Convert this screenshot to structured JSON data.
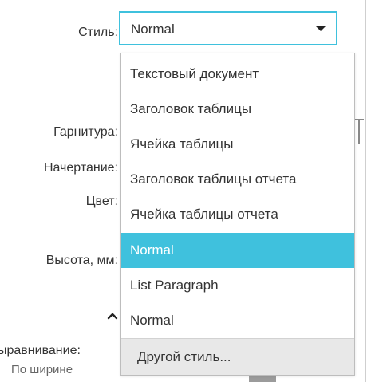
{
  "form": {
    "style_label": "Стиль:",
    "font_label": "Гарнитура:",
    "face_label": "Начертание:",
    "color_label": "Цвет:",
    "height_label": "Высота, мм:",
    "align_label": "ыравнивание:",
    "align_value": "По ширине"
  },
  "style_select": {
    "value": "Normal"
  },
  "dropdown": {
    "options": [
      "Текстовый документ",
      "Заголовок таблицы",
      "Ячейка таблицы",
      "Заголовок таблицы отчета",
      "Ячейка таблицы отчета",
      "Normal",
      "List Paragraph",
      "Normal"
    ],
    "selected_index": 5,
    "other_style": "Другой стиль..."
  },
  "icons": {
    "select_caret": "caret-down-icon",
    "collapse": "chevron-up-icon"
  },
  "colors": {
    "accent": "#3fc1dd",
    "text": "#333333",
    "muted_text": "#666666",
    "footer_bg": "#e8e8e8"
  }
}
